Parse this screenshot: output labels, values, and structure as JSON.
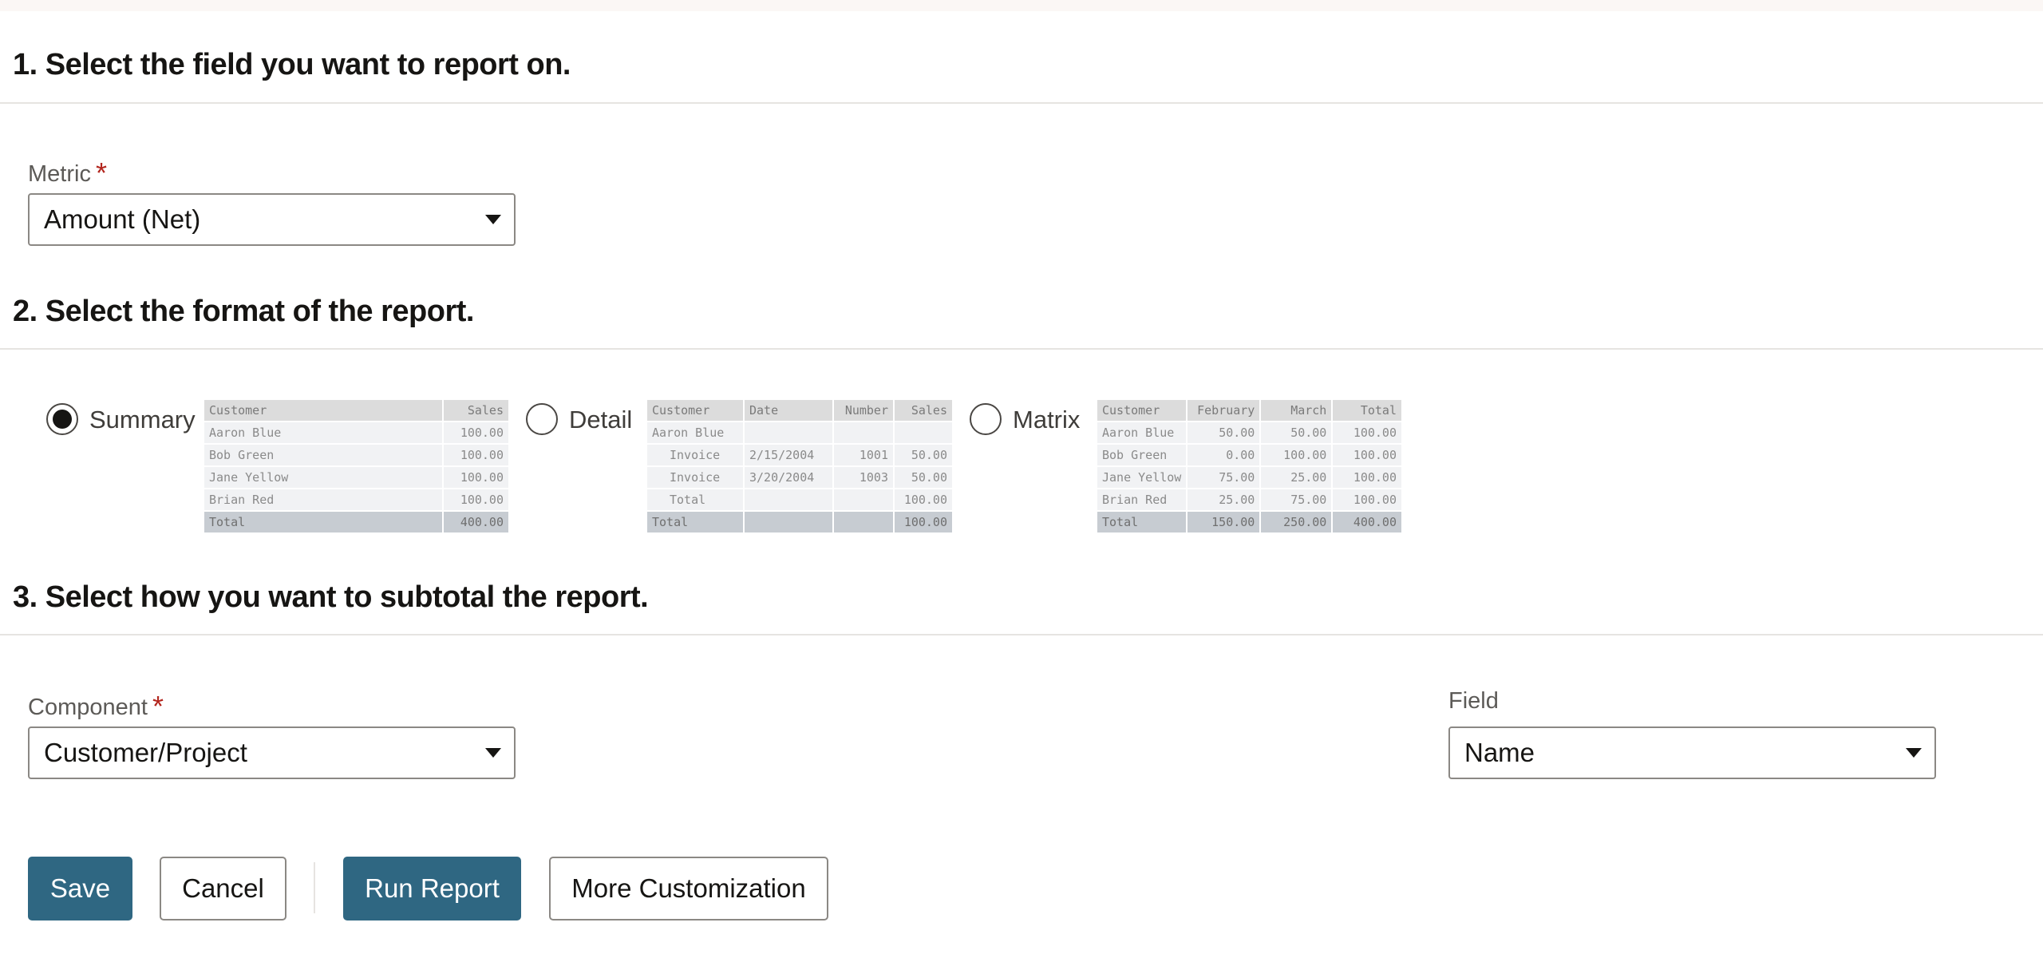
{
  "sections": {
    "s1": "1. Select the field you want to report on.",
    "s2": "2. Select the format of the report.",
    "s3": "3. Select how you want to subtotal the report."
  },
  "metric": {
    "label": "Metric",
    "required": "*",
    "value": "Amount (Net)"
  },
  "formats": {
    "summary": {
      "label": "Summary",
      "selected": true,
      "header": [
        "Customer",
        "Sales"
      ],
      "rows": [
        [
          "Aaron Blue",
          "100.00"
        ],
        [
          "Bob Green",
          "100.00"
        ],
        [
          "Jane Yellow",
          "100.00"
        ],
        [
          "Brian Red",
          "100.00"
        ]
      ],
      "total": [
        "Total",
        "400.00"
      ]
    },
    "detail": {
      "label": "Detail",
      "selected": false,
      "header": [
        "Customer",
        "Date",
        "Number",
        "Sales"
      ],
      "rows": [
        [
          "Aaron Blue",
          "",
          "",
          ""
        ],
        [
          "Invoice",
          "2/15/2004",
          "1001",
          "50.00"
        ],
        [
          "Invoice",
          "3/20/2004",
          "1003",
          "50.00"
        ],
        [
          "Total",
          "",
          "",
          "100.00"
        ]
      ],
      "total": [
        "Total",
        "",
        "",
        "100.00"
      ]
    },
    "matrix": {
      "label": "Matrix",
      "selected": false,
      "header": [
        "Customer",
        "February",
        "March",
        "Total"
      ],
      "rows": [
        [
          "Aaron Blue",
          "50.00",
          "50.00",
          "100.00"
        ],
        [
          "Bob Green",
          "0.00",
          "100.00",
          "100.00"
        ],
        [
          "Jane Yellow",
          "75.00",
          "25.00",
          "100.00"
        ],
        [
          "Brian Red",
          "25.00",
          "75.00",
          "100.00"
        ]
      ],
      "total": [
        "Total",
        "150.00",
        "250.00",
        "400.00"
      ]
    }
  },
  "component": {
    "label": "Component",
    "required": "*",
    "value": "Customer/Project"
  },
  "field": {
    "label": "Field",
    "value": "Name"
  },
  "buttons": {
    "save": "Save",
    "cancel": "Cancel",
    "run_report": "Run Report",
    "more_customization": "More Customization"
  },
  "colors": {
    "primary": "#2f6782",
    "required": "#b3261e"
  }
}
